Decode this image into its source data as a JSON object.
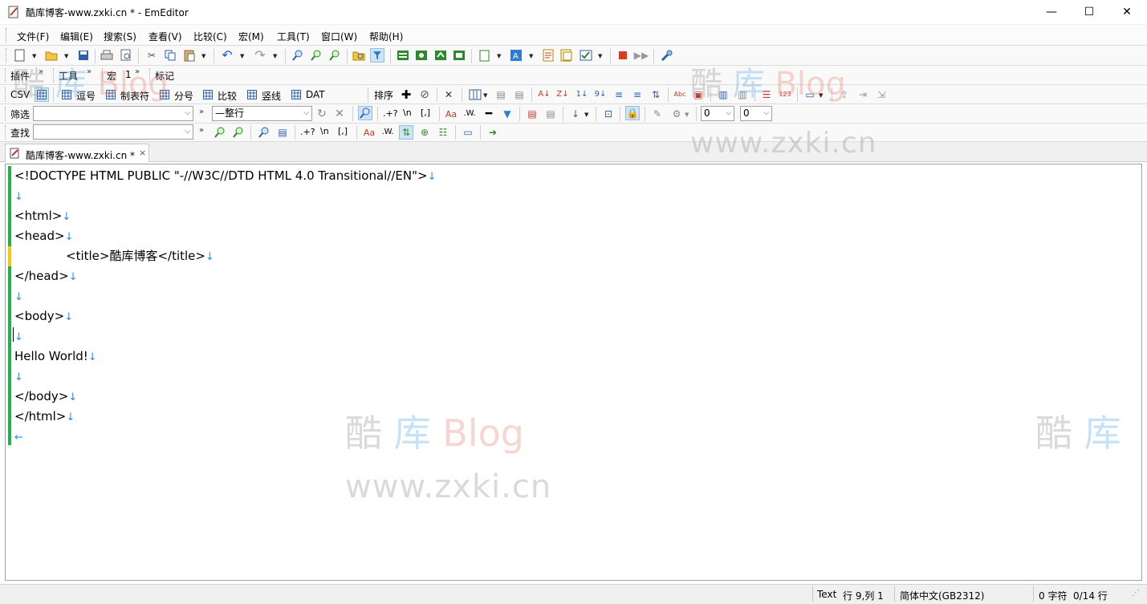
{
  "window": {
    "title": "酷库博客-www.zxki.cn * - EmEditor",
    "minimize_glyph": "—",
    "maximize_glyph": "☐",
    "close_glyph": "✕"
  },
  "menu": [
    "文件(F)",
    "编辑(E)",
    "搜索(S)",
    "查看(V)",
    "比较(C)",
    "宏(M)",
    "工具(T)",
    "窗口(W)",
    "帮助(H)"
  ],
  "toolbar3": {
    "plugins": "插件",
    "tools": "工具",
    "macro": "宏",
    "macro_extra": "1",
    "marker": "标记"
  },
  "toolbar4": {
    "csv": "CSV",
    "comma": "逗号",
    "tab": "制表符",
    "semicolon": "分号",
    "compare": "比较",
    "vertical": "竖线",
    "dat": "DAT",
    "sort": "排序"
  },
  "filter_bar": {
    "label": "筛选",
    "value": "",
    "scope": "—整行",
    "regex_dotplus": ".+?",
    "newline": "\\n",
    "bracket": "[,]",
    "num1": "0",
    "num2": "0"
  },
  "find_bar": {
    "label": "查找",
    "value": "",
    "regex_dotplus": ".+?",
    "newline": "\\n",
    "bracket": "[,]"
  },
  "tab": {
    "label": "酷库博客-www.zxki.cn *",
    "close": "×"
  },
  "editor": {
    "lines": [
      "<!DOCTYPE HTML PUBLIC \"-//W3C//DTD HTML 4.0 Transitional//EN\">",
      "",
      "<html>",
      "<head>",
      "\t<title>酷库博客</title>",
      "</head>",
      "",
      "<body>",
      "",
      "Hello World!",
      "",
      "</body>",
      "</html>",
      ""
    ],
    "eol_mark": "↓",
    "eof_mark": "←"
  },
  "watermarks": {
    "brand_a": "酷",
    "brand_b": "库",
    "brand_c": "Blog",
    "url": "www.zxki.cn"
  },
  "status": {
    "mode": "Text",
    "position": "行 9,列 1",
    "encoding": "简体中文(GB2312)",
    "chars": "0 字符",
    "lines": "0/14 行"
  },
  "colors": {
    "gutter_green": "#22b14c",
    "gutter_yellow": "#f5c518",
    "eol_blue": "#1e90ff"
  }
}
